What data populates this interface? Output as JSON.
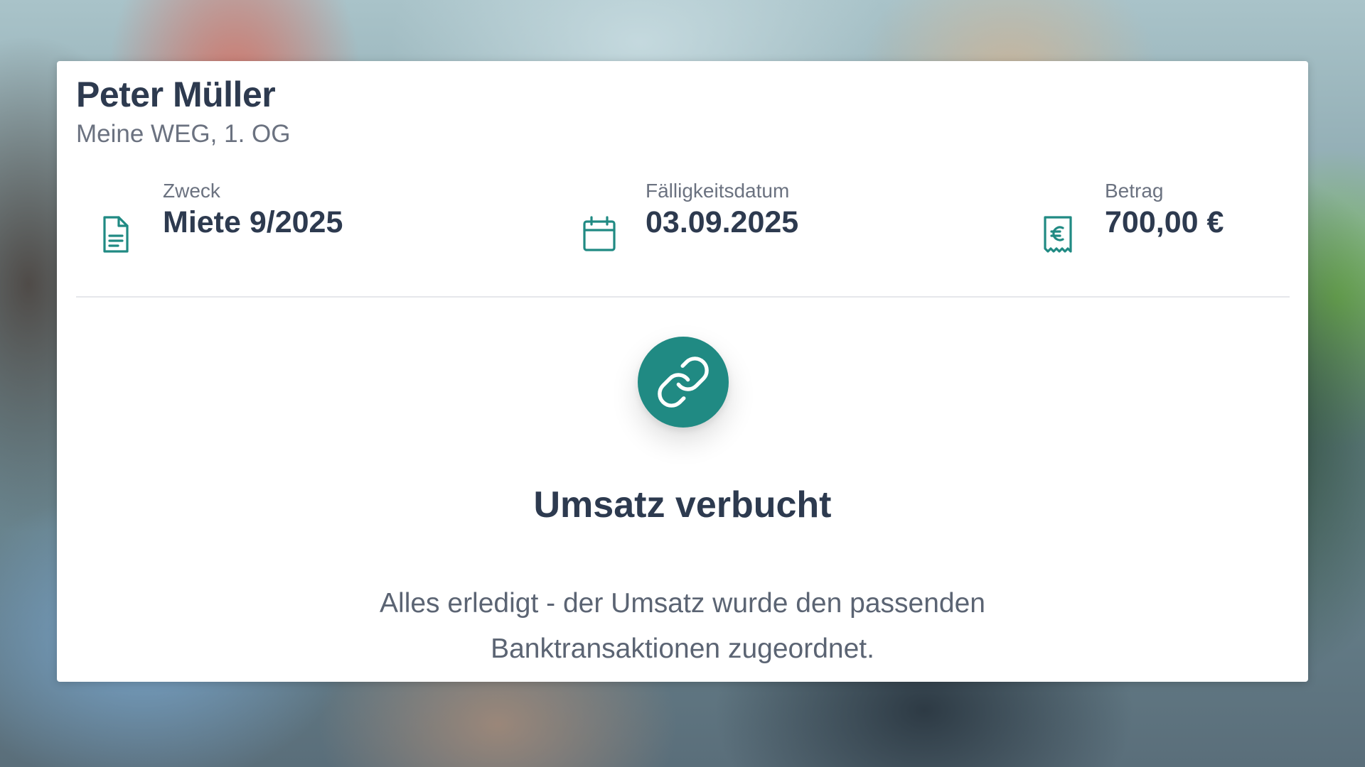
{
  "tenant": {
    "name": "Peter Müller",
    "unit": "Meine WEG, 1. OG"
  },
  "details": {
    "purpose": {
      "label": "Zweck",
      "value": "Miete 9/2025",
      "icon": "document-icon"
    },
    "due_date": {
      "label": "Fälligkeitsdatum",
      "value": "03.09.2025",
      "icon": "calendar-icon"
    },
    "amount": {
      "label": "Betrag",
      "value": "700,00 €",
      "icon": "receipt-euro-icon"
    }
  },
  "status": {
    "icon": "link-icon",
    "title": "Umsatz verbucht",
    "message": "Alles erledigt - der Umsatz wurde den passenden Banktransaktionen zugeordnet."
  },
  "colors": {
    "accent": "#208a83",
    "heading": "#2d3a4f",
    "muted": "#6b7280"
  }
}
